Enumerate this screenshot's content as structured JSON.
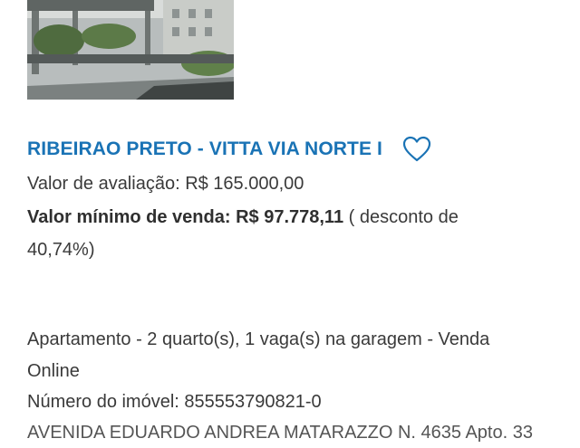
{
  "listing": {
    "title": "RIBEIRAO PRETO - VITTA VIA NORTE I",
    "appraisal_label": "Valor de avaliação:",
    "appraisal_value": "R$ 165.000,00",
    "min_sale_label": "Valor mínimo de venda:",
    "min_sale_value": "R$ 97.778,11",
    "discount_open": "( desconto de",
    "discount_close": "40,74%)",
    "type_line_1": "Apartamento - 2 quarto(s), 1 vaga(s) na garagem - Venda",
    "type_line_2": "Online",
    "property_number": "Número do imóvel: 855553790821-0",
    "address_partial": "AVENIDA EDUARDO ANDREA MATARAZZO N. 4635 Apto. 33"
  },
  "icons": {
    "favorite": "heart-outline-icon"
  },
  "colors": {
    "title": "#1a73b5",
    "text": "#3a3a3a",
    "heart": "#1a73b5"
  }
}
